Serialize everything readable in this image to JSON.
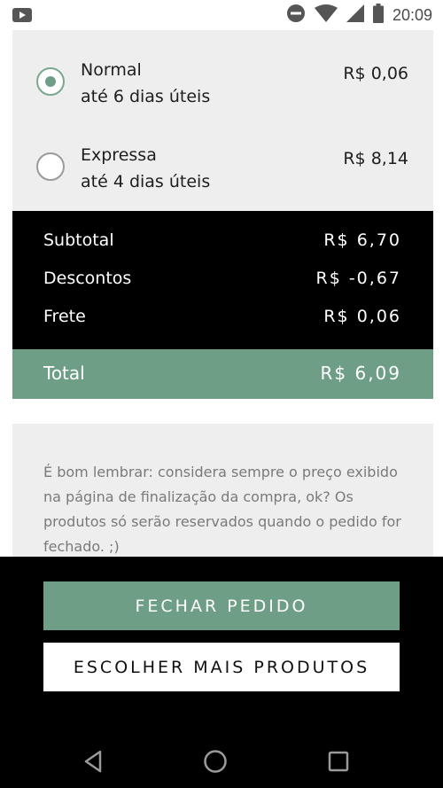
{
  "status_bar": {
    "time": "20:09",
    "icons": [
      "youtube-icon",
      "do-not-disturb-icon",
      "wifi-icon",
      "cell-signal-icon",
      "battery-icon"
    ]
  },
  "shipping": {
    "options": [
      {
        "name": "Normal",
        "time": "até 6 dias úteis",
        "price": "R$ 0,06",
        "selected": true
      },
      {
        "name": "Expressa",
        "time": "até 4 dias úteis",
        "price": "R$ 8,14",
        "selected": false
      }
    ]
  },
  "summary": {
    "subtotal_label": "Subtotal",
    "subtotal_value": "R$ 6,70",
    "discount_label": "Descontos",
    "discount_value": "R$ -0,67",
    "shipping_label": "Frete",
    "shipping_value": "R$ 0,06",
    "total_label": "Total",
    "total_value": "R$ 6,09"
  },
  "notice": {
    "text": "É bom lembrar: considera sempre o preço exibido na página de finalização da compra, ok? Os produtos só serão reservados quando o pedido for fechado. ;)"
  },
  "actions": {
    "primary_label": "FECHAR PEDIDO",
    "secondary_label": "ESCOLHER MAIS PRODUTOS"
  },
  "colors": {
    "accent": "#6e9f86",
    "panel": "#eeeeee",
    "dark": "#000000"
  }
}
